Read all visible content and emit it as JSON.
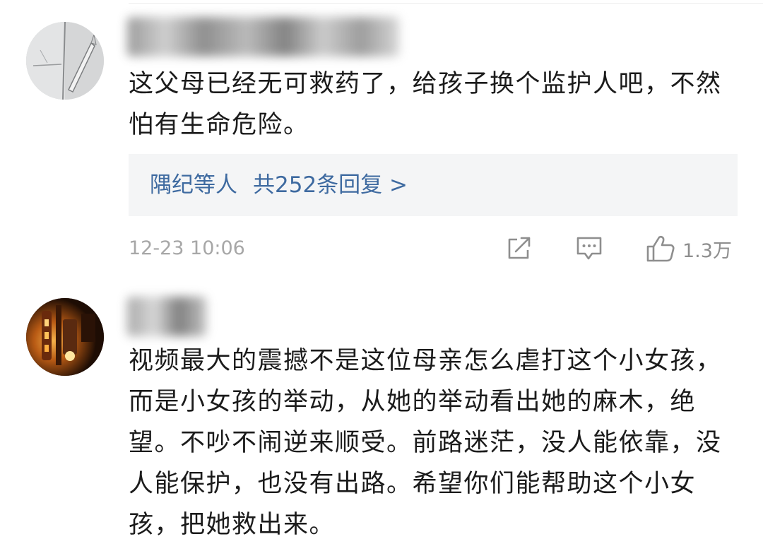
{
  "comments": [
    {
      "text": "这父母已经无可救药了，给孩子换个监护人吧，不然怕有生命危险。",
      "replies": {
        "names": "隅纪等人",
        "count_text": "共252条回复 >"
      },
      "time": "12-23 10:06",
      "likes": "1.3万",
      "icons": [
        "share-icon",
        "reply-icon",
        "like-icon"
      ]
    },
    {
      "text": "视频最大的震撼不是这位母亲怎么虐打这个小女孩，而是小女孩的举动，从她的举动看出她的麻木，绝望。不吵不闹逆来顺受。前路迷茫，没人能依靠，没人能保护，也没有出路。希望你们能帮助这个小女孩，把她救出来。"
    }
  ],
  "colors": {
    "link": "#3e6aa0",
    "meta": "#a7a7a7",
    "replies_bg": "#f4f5f6",
    "text": "#1b1b1b"
  }
}
